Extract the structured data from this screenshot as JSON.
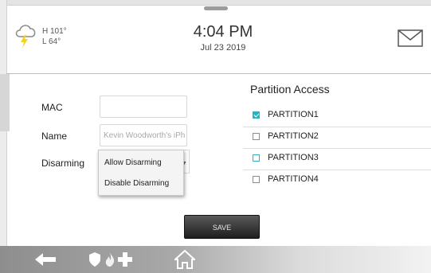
{
  "weather": {
    "icon": "cloud-lightning-icon",
    "high": "H 101°",
    "low": "L 64°"
  },
  "header": {
    "time": "4:04 PM",
    "date": "Jul 23 2019",
    "mail_icon": "envelope-icon"
  },
  "form": {
    "mac_label": "MAC",
    "mac_value": "",
    "name_label": "Name",
    "name_value": "Kevin Woodworth's iPh",
    "disarming_label": "Disarming",
    "disarming_options": [
      "Allow Disarming",
      "Disable Disarming"
    ]
  },
  "partition_access": {
    "title": "Partition Access",
    "items": [
      {
        "label": "PARTITION1",
        "checked": true
      },
      {
        "label": "PARTITION2",
        "checked": false
      },
      {
        "label": "PARTITION3",
        "checked": false
      },
      {
        "label": "PARTITION4",
        "checked": false
      }
    ]
  },
  "save_label": "SAVE",
  "footer": {
    "icons": [
      "back-arrow-icon",
      "shield-icon",
      "fire-icon",
      "medical-cross-icon",
      "home-icon"
    ]
  },
  "colors": {
    "accent": "#2ab3c0",
    "button": "#2f2f2f"
  }
}
